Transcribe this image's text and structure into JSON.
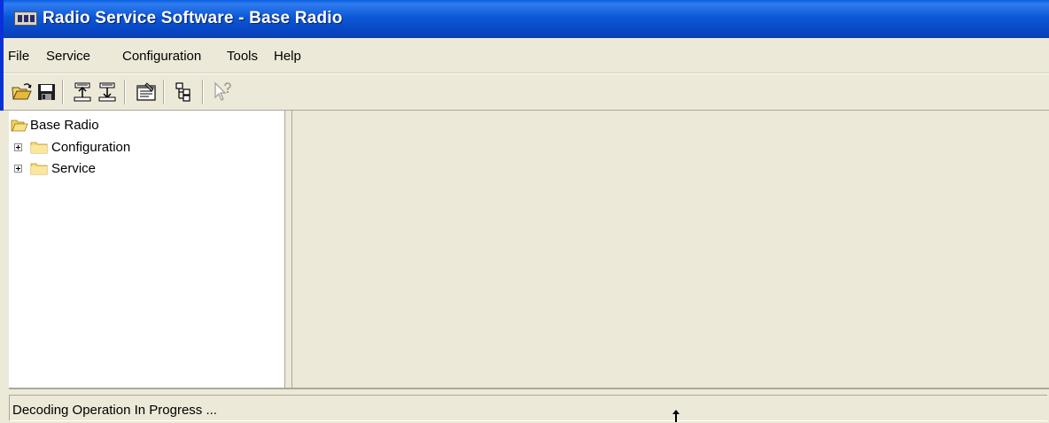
{
  "window": {
    "title": "Radio Service Software - Base Radio",
    "title_bar_color": "#0b58d6",
    "background_color": "#ece9d8"
  },
  "menu": {
    "items": [
      {
        "label": "File"
      },
      {
        "label": "Service"
      },
      {
        "label": "Configuration"
      },
      {
        "label": "Tools"
      },
      {
        "label": "Help"
      }
    ]
  },
  "toolbar": {
    "buttons": [
      {
        "icon": "open-folder-icon"
      },
      {
        "icon": "save-icon"
      },
      {
        "icon": "upload-icon"
      },
      {
        "icon": "download-icon"
      },
      {
        "icon": "properties-icon"
      },
      {
        "icon": "tree-view-icon"
      },
      {
        "icon": "context-help-icon"
      }
    ]
  },
  "tree": {
    "root": {
      "label": "Base Radio"
    },
    "children": [
      {
        "label": "Configuration",
        "expanded": false
      },
      {
        "label": "Service",
        "expanded": false
      }
    ]
  },
  "status": {
    "text": "Decoding Operation In Progress ..."
  }
}
